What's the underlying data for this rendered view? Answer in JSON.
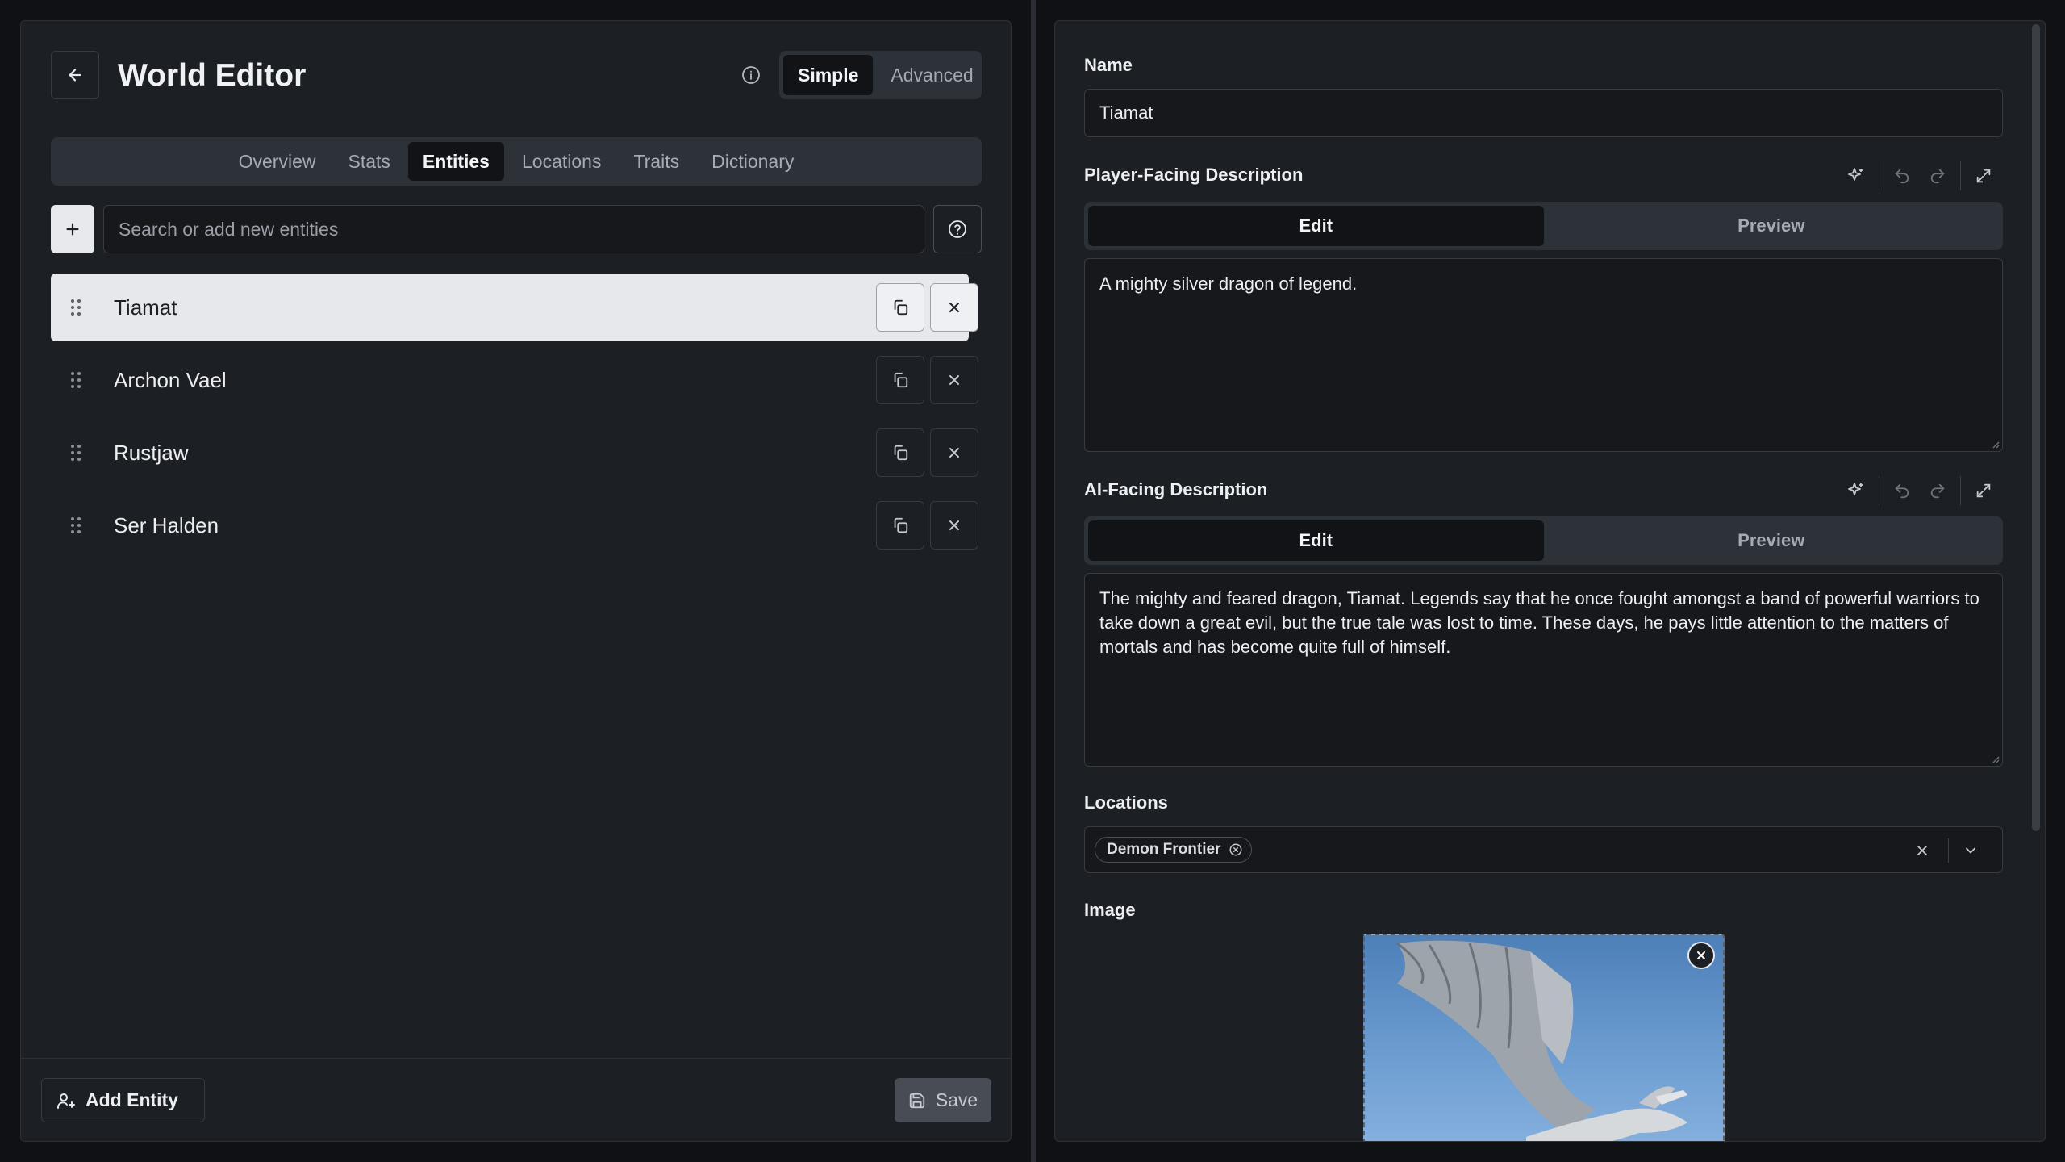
{
  "app": {
    "title": "World Editor"
  },
  "mode": {
    "options": [
      "Simple",
      "Advanced"
    ],
    "selected": "Simple"
  },
  "tabs": [
    "Overview",
    "Stats",
    "Entities",
    "Locations",
    "Traits",
    "Dictionary"
  ],
  "active_tab": "Entities",
  "search": {
    "placeholder": "Search or add new entities",
    "value": ""
  },
  "entities": [
    {
      "name": "Tiamat",
      "selected": true
    },
    {
      "name": "Archon Vael",
      "selected": false
    },
    {
      "name": "Rustjaw",
      "selected": false
    },
    {
      "name": "Ser Halden",
      "selected": false
    }
  ],
  "footer": {
    "add_entity_label": "Add Entity",
    "save_label": "Save"
  },
  "detail": {
    "name_label": "Name",
    "name_value": "Tiamat",
    "player_desc": {
      "label": "Player-Facing Description",
      "edit_label": "Edit",
      "preview_label": "Preview",
      "text": "A mighty silver dragon of legend."
    },
    "ai_desc": {
      "label": "AI-Facing Description",
      "edit_label": "Edit",
      "preview_label": "Preview",
      "text": "The mighty and feared dragon, Tiamat. Legends say that he once fought amongst a band of powerful warriors to take down a great evil, but the true tale was lost to time. These days, he pays little attention to the matters of mortals and has become quite full of himself."
    },
    "locations": {
      "label": "Locations",
      "chips": [
        "Demon Frontier"
      ]
    },
    "image": {
      "label": "Image"
    }
  },
  "colors": {
    "background": "#0f1114",
    "panel": "#1c1f24",
    "selected_row": "#e6e8ec",
    "sky": "#6f9fd2"
  }
}
